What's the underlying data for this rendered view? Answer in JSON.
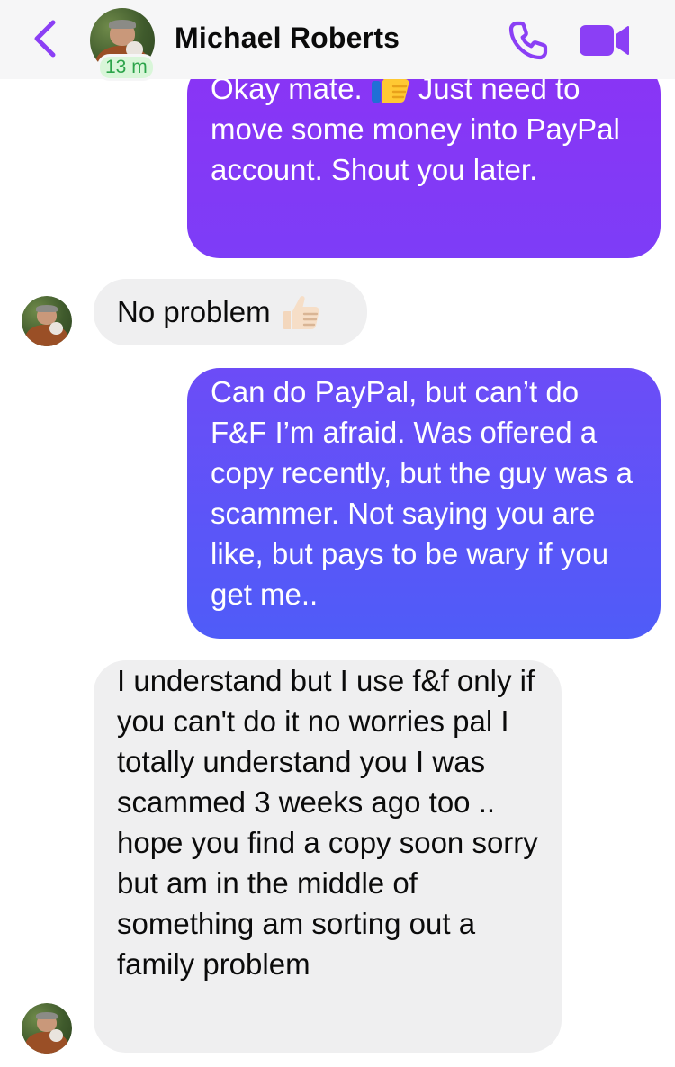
{
  "header": {
    "back_icon": "chevron-left-icon",
    "contact_name": "Michael Roberts",
    "active_status": "13 m",
    "call_icon": "phone-icon",
    "video_icon": "video-camera-icon",
    "accent_color": "#8b3ff5"
  },
  "messages": [
    {
      "direction": "outgoing",
      "text_before_emoji": "Okay mate.",
      "emoji": "thumbs-up",
      "text_after_emoji": "Just need to move some money into PayPal account. Shout you later."
    },
    {
      "direction": "incoming",
      "text": "No problem",
      "emoji": "thumbs-up-light-skin"
    },
    {
      "direction": "outgoing",
      "text": "Can do PayPal, but can’t do F&F I’m afraid. Was offered a copy recently, but the guy was a scammer. Not saying you are like, but pays to be wary if you get me.."
    },
    {
      "direction": "incoming",
      "text": "I understand but I use f&f only if you can't do it no worries pal I totally understand you I was scammed 3 weeks ago too .. hope you find a copy soon sorry but am in the middle of something am sorting out a family problem"
    }
  ]
}
